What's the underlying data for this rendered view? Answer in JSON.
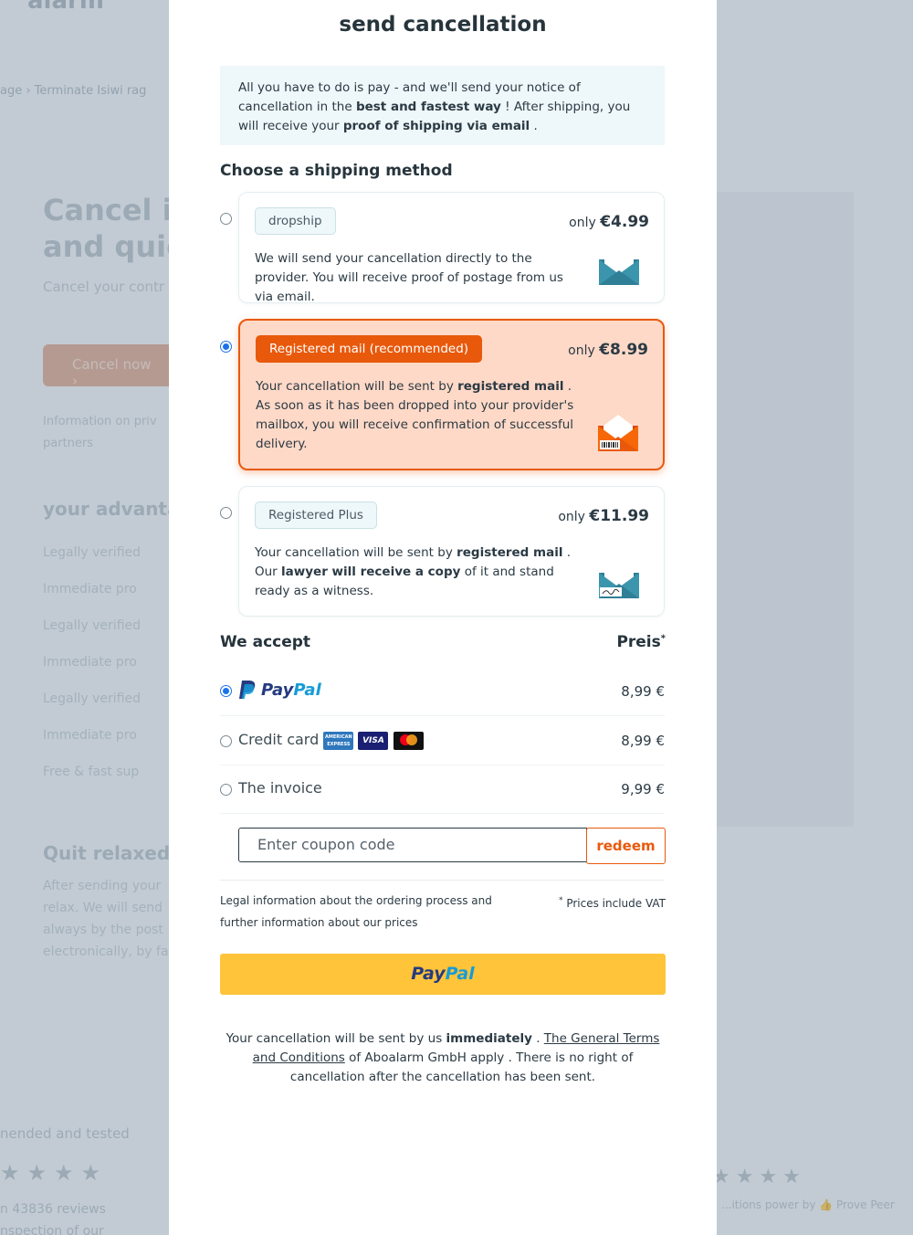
{
  "background": {
    "logo": "alarm",
    "breadcrumb": "age  ›  Terminate Isiwi rag",
    "hero": "Cancel in\nand quic",
    "hero_sub": "Cancel your contr",
    "cta": "Cancel now  ›",
    "small_info": "Information on priv partners",
    "advantages_title": "your advanta",
    "advantages": [
      "Legally verified",
      "Immediate pro",
      "Legally verified",
      "Immediate pro",
      "Legally verified",
      "Immediate pro",
      "Free & fast sup"
    ],
    "quit_title": "Quit relaxed -",
    "quit_text": "After sending your relax. We will send always by the post electronically, by fa",
    "tested": "nended and tested",
    "stars": "★★★★",
    "reviews": "n 43836 reviews\nnspection of our",
    "right_stars": "★★★★",
    "right_reviews": "...itions power by 👍 Prove Peer"
  },
  "modal": {
    "title": "send cancellation",
    "info": {
      "part1": "All you have to do is pay - and we'll send your notice of cancellation in the ",
      "bold1": "best and fastest way",
      "part2": " ! After shipping, you will receive your ",
      "bold2": "proof of shipping via email",
      "part3": " ."
    },
    "shipping_heading": "Choose a shipping method",
    "options": [
      {
        "label": "dropship",
        "price_prefix": "only",
        "price": "€4.99",
        "desc_plain": "We will send your cancellation directly to the provider. You will receive proof of postage from us via email.",
        "selected": false
      },
      {
        "label": "Registered mail (recommended)",
        "price_prefix": "only",
        "price": "€8.99",
        "desc_a": "Your cancellation will be sent by ",
        "desc_b": "registered mail",
        "desc_c": " . As soon as it has been dropped into your provider's mailbox, you will receive confirmation of successful delivery.",
        "selected": true
      },
      {
        "label": "Registered Plus",
        "price_prefix": "only",
        "price": "€11.99",
        "desc_a": "Your cancellation will be sent by ",
        "desc_b": "registered mail",
        "desc_c": " . Our ",
        "desc_d": "lawyer will receive a copy",
        "desc_e": " of it and stand ready as a witness.",
        "selected": false
      }
    ],
    "accept_heading": "We accept",
    "price_heading": "Preis",
    "price_star": "*",
    "payments": [
      {
        "label": "PayPal",
        "amount": "8,99 €",
        "selected": true
      },
      {
        "label": "Credit card",
        "amount": "8,99 €",
        "selected": false
      },
      {
        "label": "The invoice",
        "amount": "9,99 €",
        "selected": false
      }
    ],
    "card_logos": [
      "AMERICAN EXPRESS",
      "VISA",
      "mastercard"
    ],
    "coupon_placeholder": "Enter coupon code",
    "redeem_label": "redeem",
    "legal_text": "Legal information about the ordering process and further information about our prices",
    "vat_star": "*",
    "vat_text": " Prices include VAT",
    "paypal_button_a": "Pay",
    "paypal_button_b": "Pal",
    "footer": {
      "a": "Your cancellation will be sent by us ",
      "b": "immediately",
      "c": " . ",
      "link": "The General Terms and Conditions",
      "d": " of Aboalarm GmbH apply . There is no right of cancellation after the cancellation has been sent."
    },
    "colors": {
      "accent": "#e8590c",
      "paypal_yellow": "#ffc439",
      "paypal_dark": "#253b80",
      "paypal_light": "#179bd7",
      "radio_blue": "#1a73e8"
    }
  }
}
